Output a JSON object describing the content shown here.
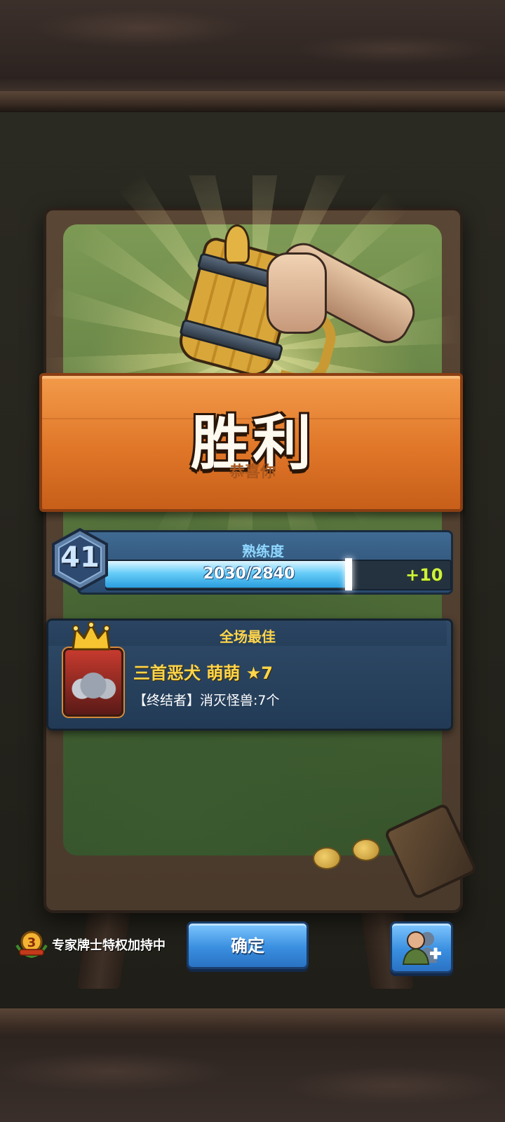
{
  "result": {
    "title": "胜利",
    "subtitle": "恭喜你"
  },
  "proficiency": {
    "label": "熟练度",
    "level": "41",
    "progress_text": "2030/2840",
    "current": 2030,
    "max": 2840,
    "gain": "+10"
  },
  "mvp": {
    "title": "全场最佳",
    "name": "三首恶犬 萌萌",
    "star": "★7",
    "description": "【终结者】消灭怪兽:7个"
  },
  "footer": {
    "expert_label": "专家牌士特权加持中",
    "confirm_label": "确定"
  },
  "icons": {
    "mug": "beer-mug-icon",
    "crown": "crown-icon",
    "level": "hexagon-level-icon",
    "expert": "expert-badge-icon",
    "add_friend": "add-friend-icon"
  },
  "colors": {
    "banner": "#e07628",
    "accent_gold": "#ffd54a",
    "progress_fill": "#68cdf8",
    "gain_green": "#cdf23c",
    "button_blue": "#3a8fe0"
  }
}
